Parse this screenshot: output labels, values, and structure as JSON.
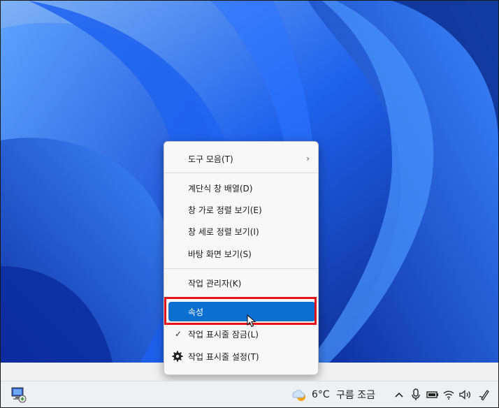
{
  "context_menu": {
    "items": [
      {
        "label": "도구 모음(T)",
        "submenu": true
      },
      {
        "label": "계단식 창 배열(D)"
      },
      {
        "label": "창 가로 정렬 보기(E)"
      },
      {
        "label": "창 세로 정렬 보기(I)"
      },
      {
        "label": "바탕 화면 보기(S)"
      },
      {
        "label": "작업 관리자(K)"
      },
      {
        "label": "속성",
        "highlighted": true
      },
      {
        "label": "작업 표시줄 잠금(L)",
        "checked": true
      },
      {
        "label": "작업 표시줄 설정(T)",
        "icon": "gear-icon"
      }
    ],
    "highlight_color": "#0a6fcf",
    "annotation_color": "#e4121a"
  },
  "taskbar": {
    "weather_temp": "6°C",
    "weather_desc": "구름 조금",
    "left_icon": "network-computer-icon",
    "tray_icons": [
      "chevron-up-icon",
      "microphone-icon",
      "battery-icon",
      "wifi-icon",
      "speaker-icon",
      "pen-icon"
    ]
  },
  "colors": {
    "wallpaper_base": "#0b3fd6",
    "taskbar_bg": "#eef0f4"
  }
}
